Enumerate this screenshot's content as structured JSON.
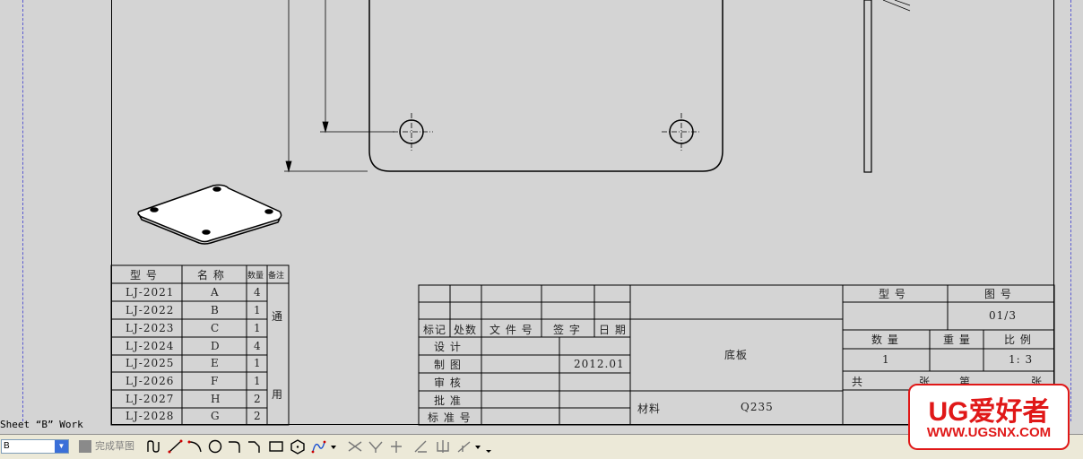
{
  "sheet_label": "Sheet “B” Work",
  "parts_table": {
    "headers": [
      "型 号",
      "名 称",
      "数量",
      "备注"
    ],
    "rows": [
      {
        "model": "LJ-2021",
        "name": "A",
        "qty": "4"
      },
      {
        "model": "LJ-2022",
        "name": "B",
        "qty": "1"
      },
      {
        "model": "LJ-2023",
        "name": "C",
        "qty": "1"
      },
      {
        "model": "LJ-2024",
        "name": "D",
        "qty": "4"
      },
      {
        "model": "LJ-2025",
        "name": "E",
        "qty": "1"
      },
      {
        "model": "LJ-2026",
        "name": "F",
        "qty": "1"
      },
      {
        "model": "LJ-2027",
        "name": "H",
        "qty": "2"
      },
      {
        "model": "LJ-2028",
        "name": "G",
        "qty": "2"
      }
    ],
    "remark_top": "通",
    "remark_bottom": "用"
  },
  "title_block": {
    "rev_headers": [
      "标记",
      "处数",
      "文 件 号",
      "签 字",
      "日 期"
    ],
    "roles": [
      "设 计",
      "制 图",
      "审 核",
      "批 准",
      "标 准 号"
    ],
    "date": "2012.01",
    "part_name": "底板",
    "material_label": "材料",
    "material_value": "Q235",
    "model_label": "型 号",
    "drawing_no_label": "图 号",
    "drawing_no": "01/3",
    "qty_label": "数 量",
    "weight_label": "重 量",
    "scale_label": "比 例",
    "qty_value": "1",
    "scale_value": "1: 3",
    "total_label": "共",
    "sheet_label": "张",
    "page_label": "第",
    "sheet_label2": "张"
  },
  "toolbar": {
    "sheet_select_value": "B",
    "finish_sketch_label": "完成草图"
  },
  "watermark": {
    "logo_text": "UG爱好者",
    "url": "WWW.UGSNX.COM"
  }
}
